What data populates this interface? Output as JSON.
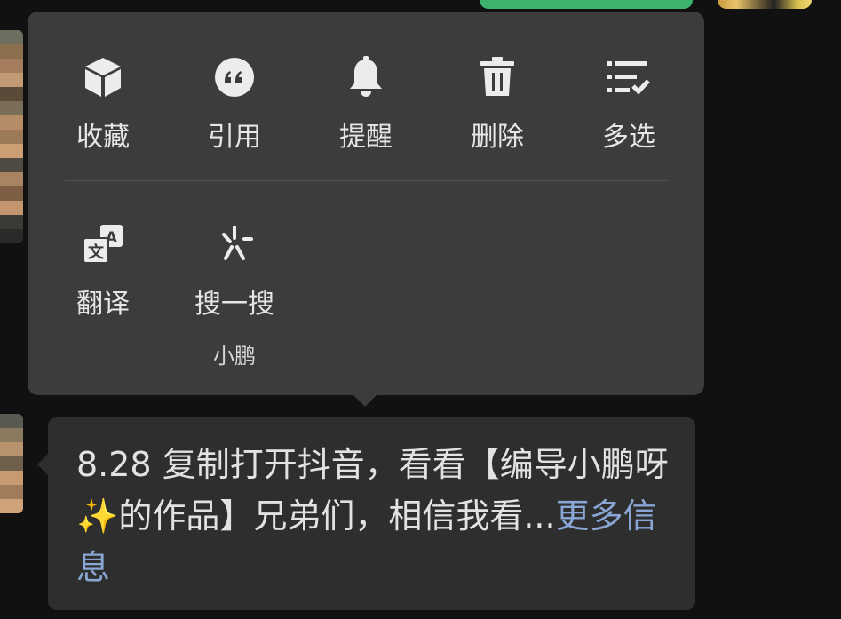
{
  "menu": {
    "row1": [
      {
        "label": "收藏",
        "icon": "cube-icon"
      },
      {
        "label": "引用",
        "icon": "quote-icon"
      },
      {
        "label": "提醒",
        "icon": "bell-icon"
      },
      {
        "label": "删除",
        "icon": "trash-icon"
      },
      {
        "label": "多选",
        "icon": "multiselect-icon"
      }
    ],
    "row2": [
      {
        "label": "翻译",
        "icon": "translate-icon"
      },
      {
        "label": "搜一搜",
        "sub": "小鹏",
        "icon": "search-sparkle-icon"
      }
    ]
  },
  "message": {
    "text": "8.28 复制打开抖音，看看【编导小鹏呀✨的作品】兄弟们，相信我看...",
    "more_link": "更多信息"
  },
  "colors": {
    "menu_bg": "#3c3c3c",
    "bubble_bg": "#2e2e2e",
    "text": "#e2e2e2",
    "link": "#8aa6d4",
    "top_button": "#3cb46e"
  }
}
